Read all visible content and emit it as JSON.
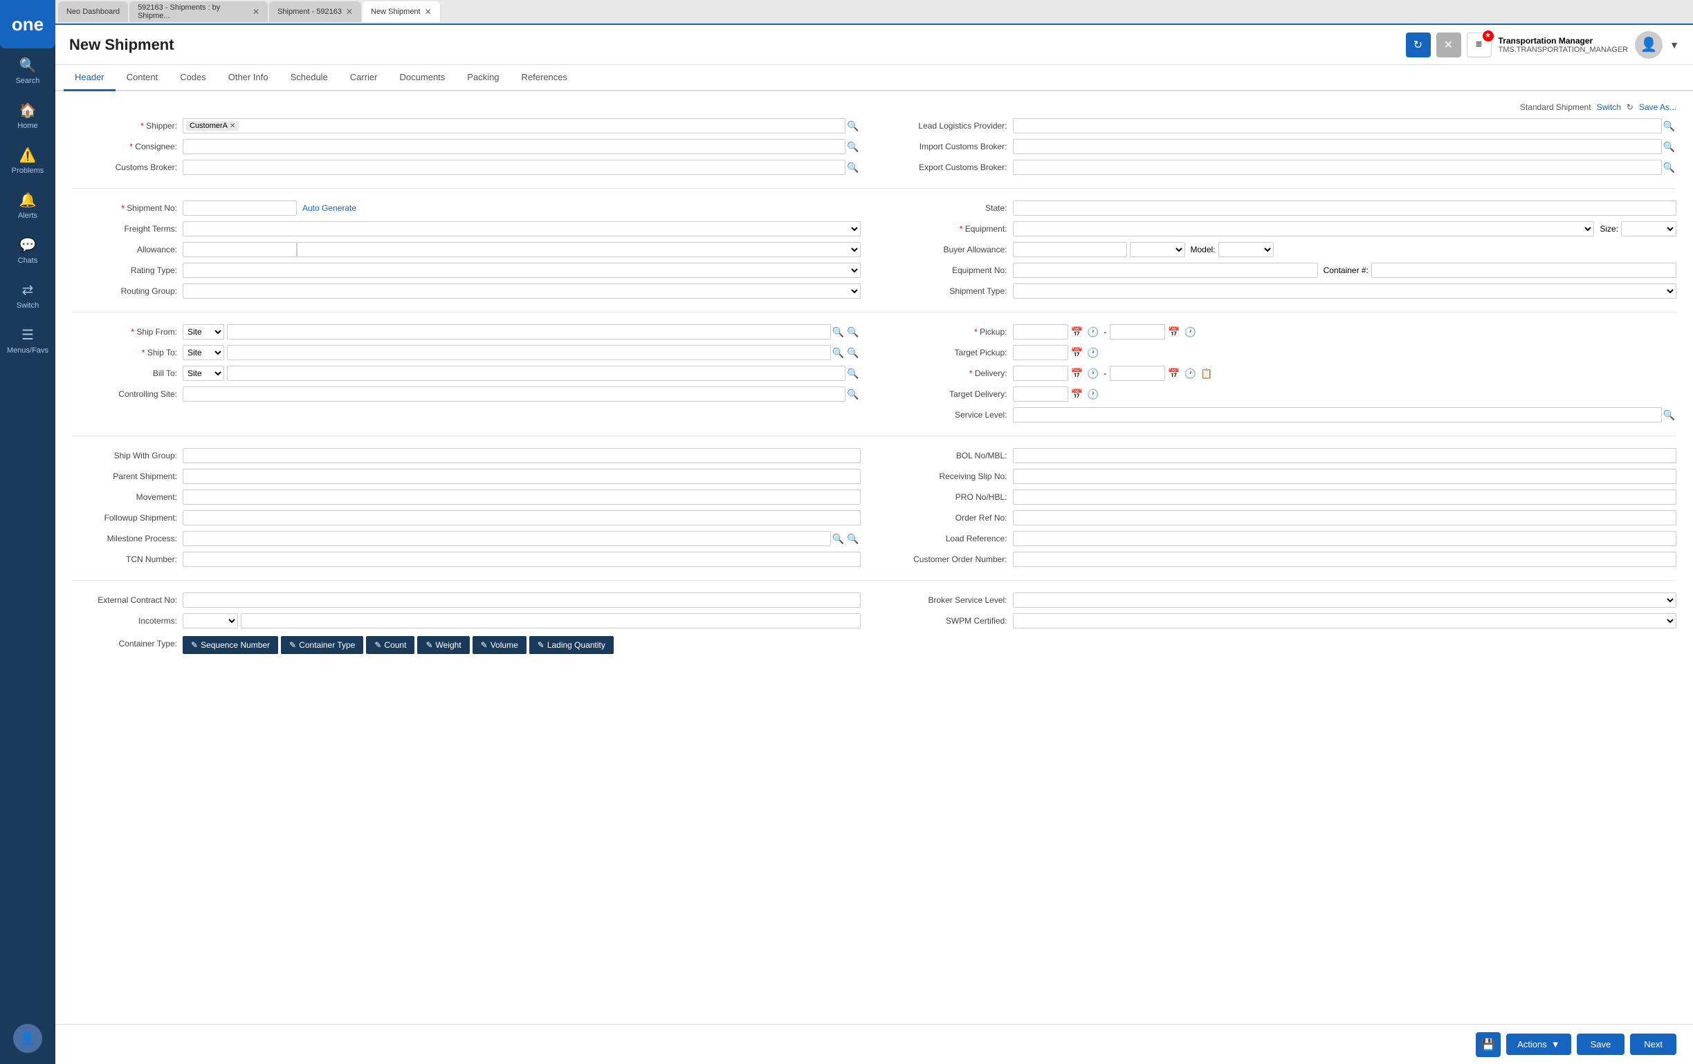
{
  "sidebar": {
    "logo": "one",
    "items": [
      {
        "id": "search",
        "label": "Search",
        "icon": "🔍"
      },
      {
        "id": "home",
        "label": "Home",
        "icon": "🏠"
      },
      {
        "id": "problems",
        "label": "Problems",
        "icon": "⚠️"
      },
      {
        "id": "alerts",
        "label": "Alerts",
        "icon": "🔔"
      },
      {
        "id": "chats",
        "label": "Chats",
        "icon": "💬"
      },
      {
        "id": "switch",
        "label": "Switch",
        "icon": "🔄"
      },
      {
        "id": "menus",
        "label": "Menus/Favs",
        "icon": "☰"
      }
    ]
  },
  "browser_tabs": [
    {
      "id": "neo-dashboard",
      "label": "Neo Dashboard",
      "active": false,
      "closable": false
    },
    {
      "id": "shipments-by",
      "label": "592163 - Shipments : by Shipme...",
      "active": false,
      "closable": true
    },
    {
      "id": "shipment-592163",
      "label": "Shipment - 592163",
      "active": false,
      "closable": true
    },
    {
      "id": "new-shipment",
      "label": "New Shipment",
      "active": true,
      "closable": true
    }
  ],
  "header": {
    "title": "New Shipment",
    "refresh_label": "↻",
    "close_label": "✕",
    "menu_label": "≡",
    "badge": "★",
    "user": {
      "name": "Transportation Manager",
      "role": "TMS.TRANSPORTATION_MANAGER"
    }
  },
  "tabs": [
    {
      "id": "header",
      "label": "Header",
      "active": true
    },
    {
      "id": "content",
      "label": "Content",
      "active": false
    },
    {
      "id": "codes",
      "label": "Codes",
      "active": false
    },
    {
      "id": "other-info",
      "label": "Other Info",
      "active": false
    },
    {
      "id": "schedule",
      "label": "Schedule",
      "active": false
    },
    {
      "id": "carrier",
      "label": "Carrier",
      "active": false
    },
    {
      "id": "documents",
      "label": "Documents",
      "active": false
    },
    {
      "id": "packing",
      "label": "Packing",
      "active": false
    },
    {
      "id": "references",
      "label": "References",
      "active": false
    }
  ],
  "std_shipment": {
    "label": "Standard Shipment",
    "switch": "Switch",
    "save_as": "Save As..."
  },
  "form": {
    "section1": {
      "shipper": {
        "label": "Shipper:",
        "required": true,
        "value": "CustomerA",
        "tag": "CustomerA"
      },
      "consignee": {
        "label": "Consignee:",
        "required": true
      },
      "customs_broker": {
        "label": "Customs Broker:"
      },
      "lead_logistics_provider": {
        "label": "Lead Logistics Provider:"
      },
      "import_customs_broker": {
        "label": "Import Customs Broker:"
      },
      "export_customs_broker": {
        "label": "Export Customs Broker:"
      }
    },
    "section2": {
      "shipment_no": {
        "label": "Shipment No:",
        "required": true,
        "auto_generate": "Auto Generate"
      },
      "freight_terms": {
        "label": "Freight Terms:"
      },
      "allowance": {
        "label": "Allowance:"
      },
      "rating_type": {
        "label": "Rating Type:"
      },
      "routing_group": {
        "label": "Routing Group:"
      },
      "state": {
        "label": "State:"
      },
      "equipment": {
        "label": "Equipment:",
        "required": true
      },
      "buyer_allowance": {
        "label": "Buyer Allowance:"
      },
      "model": {
        "label": "Model:"
      },
      "equipment_no": {
        "label": "Equipment No:"
      },
      "container_hash": {
        "label": "Container #:"
      },
      "size": {
        "label": "Size:"
      },
      "shipment_type": {
        "label": "Shipment Type:"
      }
    },
    "section3": {
      "ship_from": {
        "label": "Ship From:",
        "required": true,
        "type_val": "Site"
      },
      "ship_to": {
        "label": "Ship To:",
        "required": true,
        "type_val": "Site"
      },
      "bill_to": {
        "label": "Bill To:",
        "type_val": "Site"
      },
      "controlling_site": {
        "label": "Controlling Site:"
      },
      "pickup": {
        "label": "Pickup:",
        "required": true
      },
      "target_pickup": {
        "label": "Target Pickup:"
      },
      "delivery": {
        "label": "Delivery:",
        "required": true
      },
      "target_delivery": {
        "label": "Target Delivery:"
      },
      "service_level": {
        "label": "Service Level:"
      }
    },
    "section4": {
      "ship_with_group": {
        "label": "Ship With Group:"
      },
      "parent_shipment": {
        "label": "Parent Shipment:"
      },
      "movement": {
        "label": "Movement:"
      },
      "followup_shipment": {
        "label": "Followup Shipment:"
      },
      "milestone_process": {
        "label": "Milestone Process:"
      },
      "tcn_number": {
        "label": "TCN Number:"
      },
      "bol_mbl": {
        "label": "BOL No/MBL:"
      },
      "receiving_slip": {
        "label": "Receiving Slip No:"
      },
      "pro_hbl": {
        "label": "PRO No/HBL:"
      },
      "order_ref": {
        "label": "Order Ref No:"
      },
      "load_reference": {
        "label": "Load Reference:"
      },
      "customer_order": {
        "label": "Customer Order Number:"
      }
    },
    "section5": {
      "external_contract": {
        "label": "External Contract No:"
      },
      "incoterms": {
        "label": "Incoterms:"
      },
      "container_type": {
        "label": "Container Type:"
      },
      "broker_service_level": {
        "label": "Broker Service Level:"
      },
      "swpm_certified": {
        "label": "SWPM Certified:"
      }
    }
  },
  "container_type_buttons": [
    {
      "id": "seq-num",
      "label": "Sequence Number",
      "icon": "✎"
    },
    {
      "id": "container-type",
      "label": "Container Type",
      "icon": "✎"
    },
    {
      "id": "count",
      "label": "Count",
      "icon": "✎"
    },
    {
      "id": "weight",
      "label": "Weight",
      "icon": "✎"
    },
    {
      "id": "volume",
      "label": "Volume",
      "icon": "✎"
    },
    {
      "id": "lading-qty",
      "label": "Lading Quantity",
      "icon": "✎"
    }
  ],
  "bottom_bar": {
    "save_icon": "💾",
    "actions_label": "Actions",
    "actions_arrow": "▼",
    "save_label": "Save",
    "next_label": "Next"
  }
}
